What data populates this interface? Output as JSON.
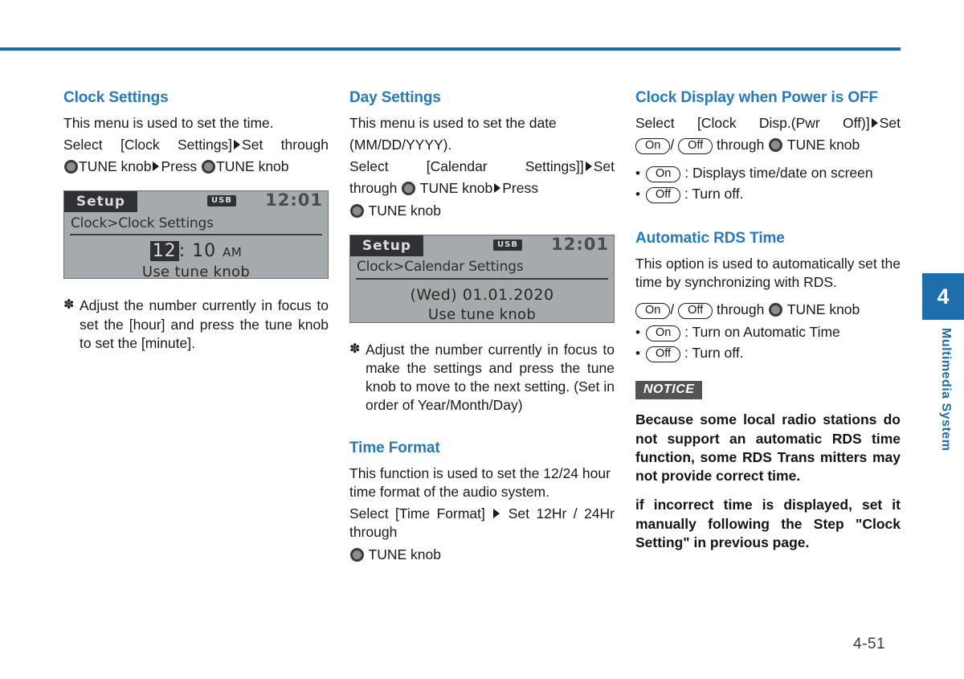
{
  "page": {
    "number": "4-51",
    "chapter_number": "4",
    "chapter_title": "Multimedia System",
    "accent_color": "#1c6fab",
    "heading_color": "#2779bd"
  },
  "column1": {
    "heading": "Clock Settings",
    "intro": "This menu is used to set the time.",
    "select_prefix": "Select [Clock Settings]",
    "select_mid": "Set through",
    "select_knob_label_1": "TUNE knob",
    "select_press": "Press",
    "select_knob_label_2": "TUNE knob",
    "lcd": {
      "title": "Setup",
      "source_badge": "USB",
      "time": "12:01",
      "path": "Clock>Clock Settings",
      "value_highlight": "12",
      "value_rest": ": 10",
      "value_ampm": "AM",
      "hint": "Use tune knob"
    },
    "note": "Adjust the number currently in focus to set the [hour] and press the tune knob to set the [minute]."
  },
  "column2": {
    "heading": "Day Settings",
    "intro_line1": "This menu is used to set the date",
    "intro_line2": "(MM/DD/YYYY).",
    "select_prefix": "Select  [Calendar  Settings]]",
    "select_mid": "Set",
    "select_through": "through",
    "select_knob_label_1": "TUNE knob",
    "select_press": "Press",
    "select_knob_label_2": "TUNE knob",
    "lcd": {
      "title": "Setup",
      "source_badge": "USB",
      "time": "12:01",
      "path": "Clock>Calendar Settings",
      "date_prefix": "(Wed) 01.01.",
      "date_highlight": "2020",
      "hint": "Use tune knob"
    },
    "note": "Adjust the number currently in focus to make the settings and press the tune knob to move to the next setting. (Set in order of Year/Month/Day)",
    "time_format": {
      "heading": "Time Format",
      "intro": "This function is used to set the 12/24 hour time format of the audio system.",
      "select_prefix": "Select [Time Format]",
      "select_mid": "Set 12Hr / 24Hr through",
      "select_knob_label": "TUNE knob"
    }
  },
  "column3": {
    "heading": "Clock Display when Power is OFF",
    "select_prefix": "Select  [Clock  Disp.(Pwr  Off)]",
    "select_mid": "Set",
    "on_label": "On",
    "off_label": "Off",
    "through_label": "through",
    "knob_label": "TUNE knob",
    "bullets": [
      {
        "pill": "On",
        "text": ": Displays time/date on screen"
      },
      {
        "pill": "Off",
        "text": ": Turn off."
      }
    ],
    "rds": {
      "heading": "Automatic RDS Time",
      "intro": "This option is used to automatically set the time by synchronizing with RDS.",
      "on_label": "On",
      "off_label": "Off",
      "through_label": "through",
      "knob_label": "TUNE knob",
      "bullets": [
        {
          "pill": "On",
          "text": ": Turn on Automatic Time"
        },
        {
          "pill": "Off",
          "text": ": Turn off."
        }
      ]
    },
    "notice": {
      "badge": "NOTICE",
      "paragraph1": "Because some local radio stations do not support an automatic RDS time function, some RDS Trans mitters may not provide correct time.",
      "paragraph2": "if incorrect time is displayed, set it manually following the Step \"Clock Setting\" in previous page."
    }
  }
}
